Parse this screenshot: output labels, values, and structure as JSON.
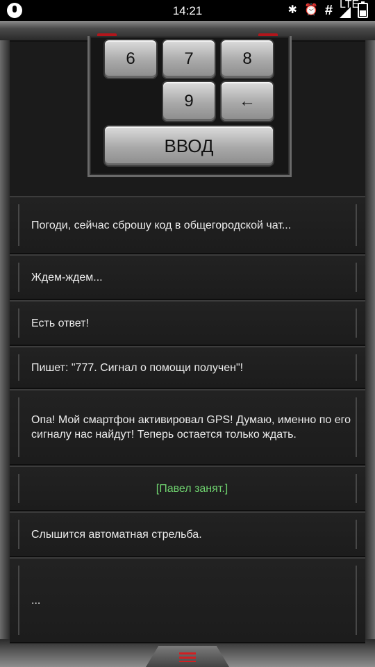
{
  "status_bar": {
    "time": "14:21",
    "icons": [
      "mic-icon",
      "bluetooth-icon",
      "alarm-icon",
      "hash-icon",
      "lte-signal-icon",
      "battery-icon"
    ],
    "lte_label": "LTE"
  },
  "keypad": {
    "keys": [
      "6",
      "7",
      "8",
      "9",
      "←"
    ],
    "enter_label": "ВВОД"
  },
  "messages": [
    {
      "text": "Погоди, сейчас сброшу код в общегородской чат..."
    },
    {
      "text": "Ждем-ждем..."
    },
    {
      "text": "Есть ответ!"
    },
    {
      "text": "Пишет: \"777. Сигнал о помощи получен\"!"
    },
    {
      "text": "Опа! Мой смартфон активировал GPS! Думаю, именно по его сигналу нас найдут! Теперь остается только ждать."
    },
    {
      "text": "[Павел занят.]",
      "color": "#6fd36f"
    },
    {
      "text": "Слышится автоматная стрельба."
    },
    {
      "text": "..."
    }
  ],
  "colors": {
    "background": "#1b1b1b",
    "accent_red": "#d11f22",
    "status_green": "#6fd36f"
  }
}
